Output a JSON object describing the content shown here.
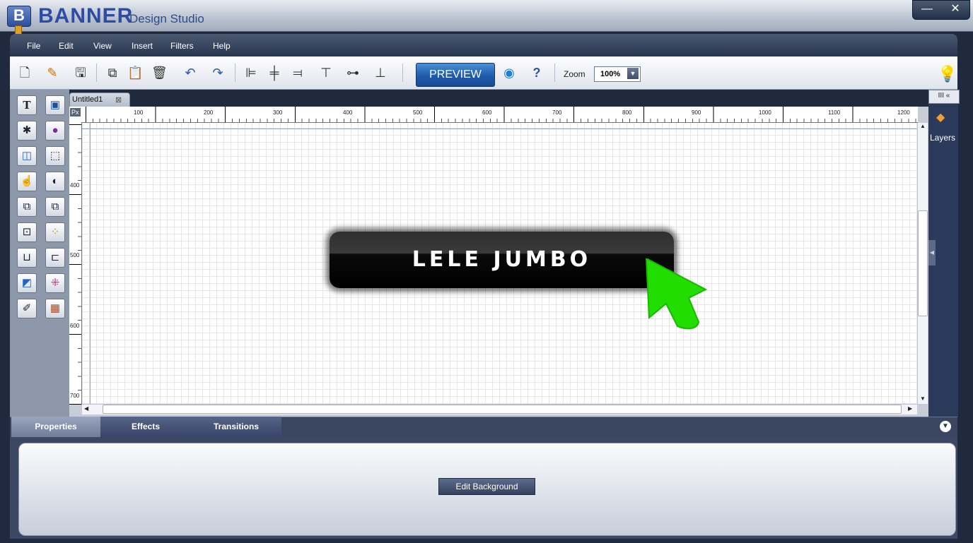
{
  "window": {
    "app_name": "BANNER",
    "app_subtitle": "Design Studio",
    "logo_letter": "B",
    "minimize": "—",
    "close": "✕"
  },
  "menu": [
    "File",
    "Edit",
    "View",
    "Insert",
    "Filters",
    "Help"
  ],
  "toolbar": {
    "preview_label": "PREVIEW",
    "zoom_label": "Zoom",
    "zoom_value": "100%",
    "icons": [
      "new-document-icon",
      "open-folder-icon",
      "save-icon",
      "copy-icon",
      "paste-icon",
      "delete-icon",
      "undo-icon",
      "redo-icon",
      "align-left-icon",
      "align-center-icon",
      "align-right-icon",
      "align-top-icon",
      "align-middle-icon",
      "align-bottom-icon",
      "web-preview-icon",
      "help-icon",
      "lightbulb-icon"
    ]
  },
  "document": {
    "tab_title": "Untitled1",
    "ruler_unit": "Px"
  },
  "ruler": {
    "top_ticks": [
      "100",
      "200",
      "300",
      "400",
      "500",
      "600",
      "700",
      "800",
      "900",
      "1000",
      "1100",
      "1200"
    ],
    "left_ticks": [
      "400",
      "500",
      "600",
      "700"
    ]
  },
  "banner": {
    "text": "LELE JUMBO",
    "cursor_color": "#22dd00"
  },
  "layers": {
    "label": "Layers",
    "header": "III «"
  },
  "bottom_tabs": [
    "Properties",
    "Effects",
    "Transitions"
  ],
  "properties": {
    "edit_background_label": "Edit Background"
  }
}
